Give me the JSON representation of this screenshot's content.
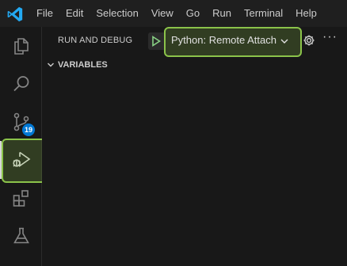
{
  "menu": [
    "File",
    "Edit",
    "Selection",
    "View",
    "Go",
    "Run",
    "Terminal",
    "Help"
  ],
  "sidebar": {
    "title": "RUN AND DEBUG",
    "config": "Python: Remote Attach",
    "more": "···",
    "section": "VARIABLES"
  },
  "activity": {
    "source_control_badge": "19"
  },
  "colors": {
    "accent": "#0078d4",
    "highlight": "#8bc34a"
  },
  "icons": [
    "vscode-logo",
    "explorer-icon",
    "search-icon",
    "source-control-icon",
    "run-debug-icon",
    "extensions-icon",
    "testing-icon",
    "play-icon",
    "chevron-down-icon",
    "gear-icon",
    "more-icon"
  ]
}
